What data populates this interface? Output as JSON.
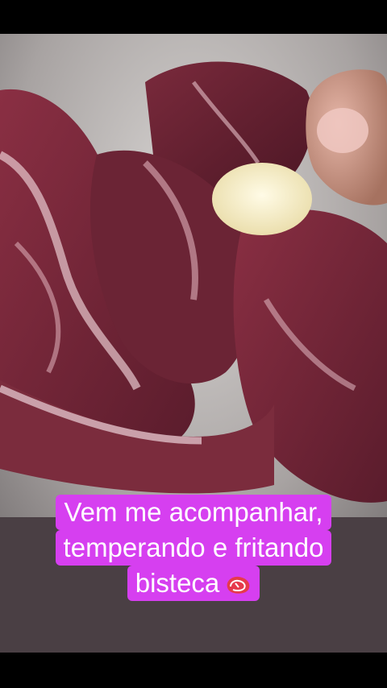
{
  "caption": {
    "line1": "Vem me acompanhar,",
    "line2": "temperando e fritando",
    "line3": "bisteca",
    "emoji_icon": "cut-of-meat-icon"
  },
  "colors": {
    "caption_bg": "#d63ff0",
    "caption_text": "#ffffff"
  }
}
